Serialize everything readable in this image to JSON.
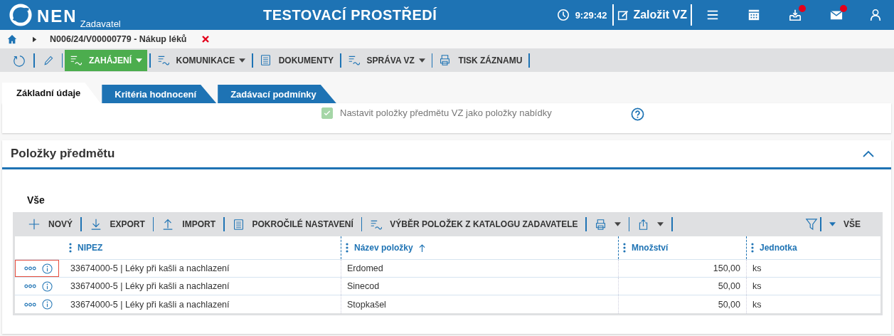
{
  "header": {
    "logo": "NEN",
    "subtitle": "Zadavatel",
    "environment": "TESTOVACÍ PROSTŘEDÍ",
    "time": "9:29:42",
    "create_button": "Založit VZ",
    "icons": [
      {
        "kind": "menu",
        "notification": false
      },
      {
        "kind": "calendar",
        "notification": false
      },
      {
        "kind": "inbox",
        "notification": true
      },
      {
        "kind": "mail",
        "notification": true
      },
      {
        "kind": "user",
        "notification": false
      }
    ]
  },
  "breadcrumb": {
    "label": "N006/24/V00000779 - Nákup léků"
  },
  "toolbar": [
    {
      "kind": "flow",
      "label": "ZAHÁJENÍ",
      "dropdown": true,
      "primary": true
    },
    {
      "kind": "flow",
      "label": "KOMUNIKACE",
      "dropdown": true,
      "primary": false
    },
    {
      "kind": "doc",
      "label": "DOKUMENTY",
      "dropdown": false,
      "primary": false
    },
    {
      "kind": "flow",
      "label": "SPRÁVA VZ",
      "dropdown": true,
      "primary": false
    },
    {
      "kind": "print",
      "label": "TISK ZÁZNAMU",
      "dropdown": false,
      "primary": false
    }
  ],
  "tabs": [
    {
      "label": "Základní údaje",
      "selected": true
    },
    {
      "label": "Kritéria hodnocení",
      "selected": false
    },
    {
      "label": "Zadávací podmínky",
      "selected": false
    }
  ],
  "option": {
    "label": "Nastavit položky předmětu VZ jako položky nabídky",
    "checked": true,
    "disabled": true
  },
  "section": {
    "title": "Položky předmětu",
    "expanded": true,
    "tabs": [
      {
        "label": "Vše",
        "selected": true
      }
    ],
    "toolbar": [
      {
        "kind": "plus",
        "label": "NOVÝ"
      },
      {
        "kind": "down",
        "label": "EXPORT"
      },
      {
        "kind": "up",
        "label": "IMPORT"
      },
      {
        "kind": "doc",
        "label": "POKROČILÉ NASTAVENÍ"
      },
      {
        "kind": "flow",
        "label": "VÝBĚR POLOŽEK Z KATALOGU ZADAVATELE"
      }
    ],
    "view_filter": "VŠE",
    "columns": [
      {
        "label": "NIPEZ",
        "sorted": false
      },
      {
        "label": "Název položky",
        "sorted": true
      },
      {
        "label": "Množství",
        "sorted": false
      },
      {
        "label": "Jednotka",
        "sorted": false
      }
    ],
    "rows": [
      {
        "focused": true,
        "cells": [
          "33674000-5 | Léky při kašli a nachlazení",
          "Erdomed",
          "150,00",
          "ks"
        ]
      },
      {
        "focused": false,
        "cells": [
          "33674000-5 | Léky při kašli a nachlazení",
          "Sinecod",
          "50,00",
          "ks"
        ]
      },
      {
        "focused": false,
        "cells": [
          "33674000-5 | Léky při kašli a nachlazení",
          "Stopkašel",
          "50,00",
          "ks"
        ]
      }
    ]
  }
}
